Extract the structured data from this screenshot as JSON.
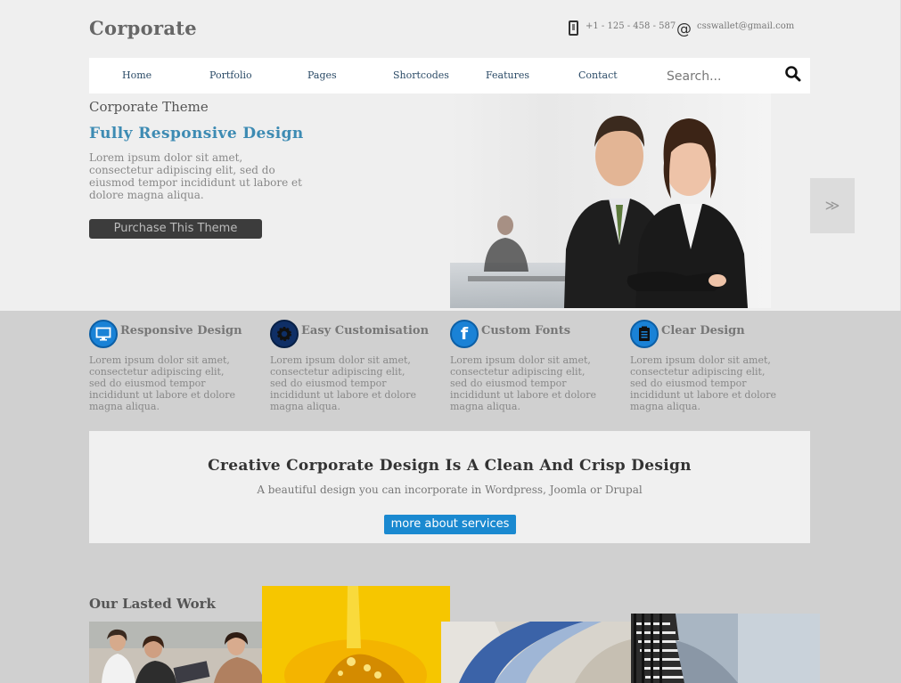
{
  "header": {
    "logo": "Corporate",
    "phone": "+1 - 125 - 458 - 587",
    "email": "csswallet@gmail.com"
  },
  "nav": {
    "items": [
      {
        "label": "Home"
      },
      {
        "label": "Portfolio"
      },
      {
        "label": "Pages"
      },
      {
        "label": "Shortcodes"
      },
      {
        "label": "Features"
      },
      {
        "label": "Contact"
      }
    ],
    "search_placeholder": "Search..."
  },
  "hero": {
    "small_title": "Corporate Theme",
    "title": "Fully Responsive Design",
    "text": "Lorem ipsum dolor sit amet, consectetur adipiscing elit, sed do eiusmod tempor incididunt ut labore et dolore magna aliqua.",
    "button_label": "Purchase This Theme",
    "next_label": "≫"
  },
  "features": [
    {
      "icon": "monitor-icon",
      "title": "Responsive Design",
      "text": "Lorem ipsum dolor sit amet, consectetur adipiscing elit, sed do eiusmod tempor incididunt ut labore et dolore magna aliqua."
    },
    {
      "icon": "gear-icon",
      "title": "Easy Customisation",
      "text": "Lorem ipsum dolor sit amet, consectetur adipiscing elit, sed do eiusmod tempor incididunt ut labore et dolore magna aliqua."
    },
    {
      "icon": "facebook-icon",
      "title": "Custom Fonts",
      "text": "Lorem ipsum dolor sit amet, consectetur adipiscing elit, sed do eiusmod tempor incididunt ut labore et dolore magna aliqua."
    },
    {
      "icon": "clipboard-icon",
      "title": "Clear Design",
      "text": "Lorem ipsum dolor sit amet, consectetur adipiscing elit, sed do eiusmod tempor incididunt ut labore et dolore magna aliqua."
    }
  ],
  "banner": {
    "title": "Creative Corporate Design Is A Clean And Crisp Design",
    "subtitle": "A beautiful design you can incorporate in Wordpress, Joomla or Drupal",
    "button_label": "more about services"
  },
  "work": {
    "title": "Our Lasted Work"
  },
  "colors": {
    "accent_blue": "#1a89d0",
    "title_blue": "#3d8bb3",
    "dark_button": "#3c3c3c"
  }
}
